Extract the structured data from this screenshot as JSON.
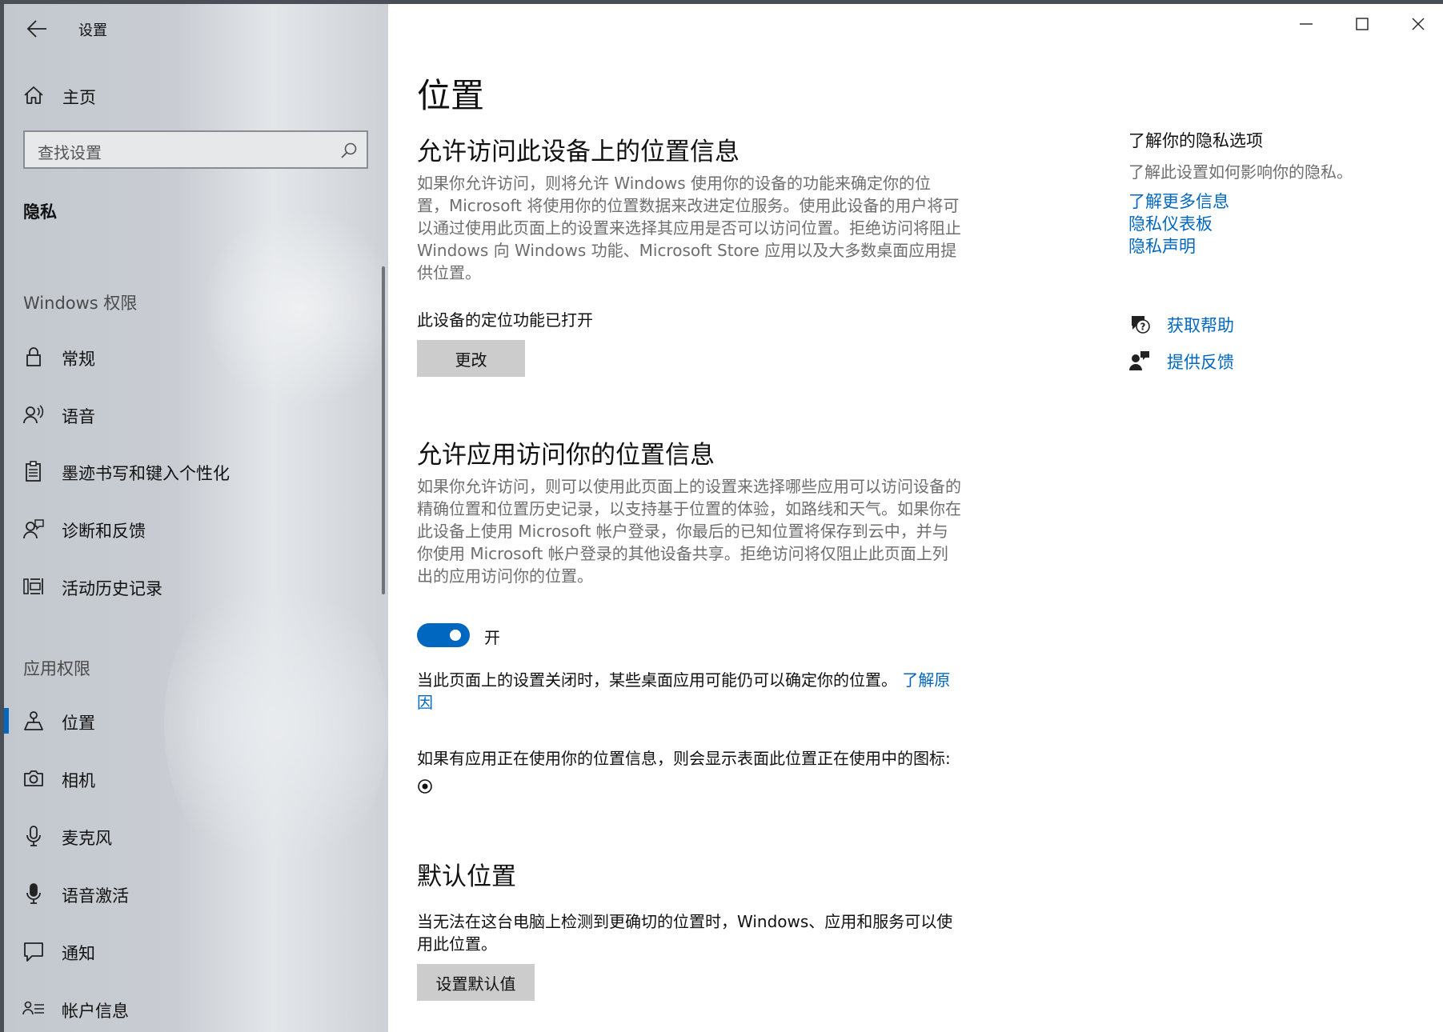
{
  "window": {
    "title": "设置"
  },
  "sidebar": {
    "home_label": "主页",
    "search_placeholder": "查找设置",
    "category": "隐私",
    "windows_permissions": {
      "heading": "Windows 权限",
      "items": [
        {
          "label": "常规",
          "icon": "lock-icon"
        },
        {
          "label": "语音",
          "icon": "speech-icon"
        },
        {
          "label": "墨迹书写和键入个性化",
          "icon": "clipboard-icon"
        },
        {
          "label": "诊断和反馈",
          "icon": "diagnostics-icon"
        },
        {
          "label": "活动历史记录",
          "icon": "activity-history-icon"
        }
      ]
    },
    "app_permissions": {
      "heading": "应用权限",
      "items": [
        {
          "label": "位置",
          "icon": "location-icon",
          "selected": true
        },
        {
          "label": "相机",
          "icon": "camera-icon"
        },
        {
          "label": "麦克风",
          "icon": "microphone-icon"
        },
        {
          "label": "语音激活",
          "icon": "voice-activation-icon"
        },
        {
          "label": "通知",
          "icon": "notification-icon"
        },
        {
          "label": "帐户信息",
          "icon": "account-info-icon"
        }
      ]
    }
  },
  "main": {
    "title": "位置",
    "device_section": {
      "heading": "允许访问此设备上的位置信息",
      "description": "如果你允许访问，则将允许 Windows 使用你的设备的功能来确定你的位置，Microsoft 将使用你的位置数据来改进定位服务。使用此设备的用户将可以通过使用此页面上的设置来选择其应用是否可以访问位置。拒绝访问将阻止 Windows 向 Windows 功能、Microsoft Store 应用以及大多数桌面应用提供位置。",
      "status": "此设备的定位功能已打开",
      "change_button": "更改"
    },
    "apps_section": {
      "heading": "允许应用访问你的位置信息",
      "description": "如果你允许访问，则可以使用此页面上的设置来选择哪些应用可以访问设备的精确位置和位置历史记录，以支持基于位置的体验，如路线和天气。如果你在此设备上使用 Microsoft 帐户登录，你最后的已知位置将保存到云中，并与你使用 Microsoft 帐户登录的其他设备共享。拒绝访问将仅阻止此页面上列出的应用访问你的位置。",
      "toggle_state": "开",
      "toggle_on": true,
      "note": "当此页面上的设置关闭时，某些桌面应用可能仍可以确定你的位置。",
      "note_link": "了解原因",
      "icon_note": "如果有应用正在使用你的位置信息，则会显示表面此位置正在使用中的图标:"
    },
    "default_section": {
      "heading": "默认位置",
      "description": "当无法在这台电脑上检测到更确切的位置时，Windows、应用和服务可以使用此位置。",
      "button": "设置默认值"
    }
  },
  "right": {
    "title": "了解你的隐私选项",
    "description": "了解此设置如何影响你的隐私。",
    "links": [
      "了解更多信息",
      "隐私仪表板",
      "隐私声明"
    ],
    "help": {
      "label": "获取帮助",
      "icon": "get-help-icon"
    },
    "feedback": {
      "label": "提供反馈",
      "icon": "feedback-icon"
    }
  },
  "colors": {
    "accent": "#0067c0",
    "button_bg": "#cccccc",
    "secondary_text": "#6e6e6e"
  }
}
